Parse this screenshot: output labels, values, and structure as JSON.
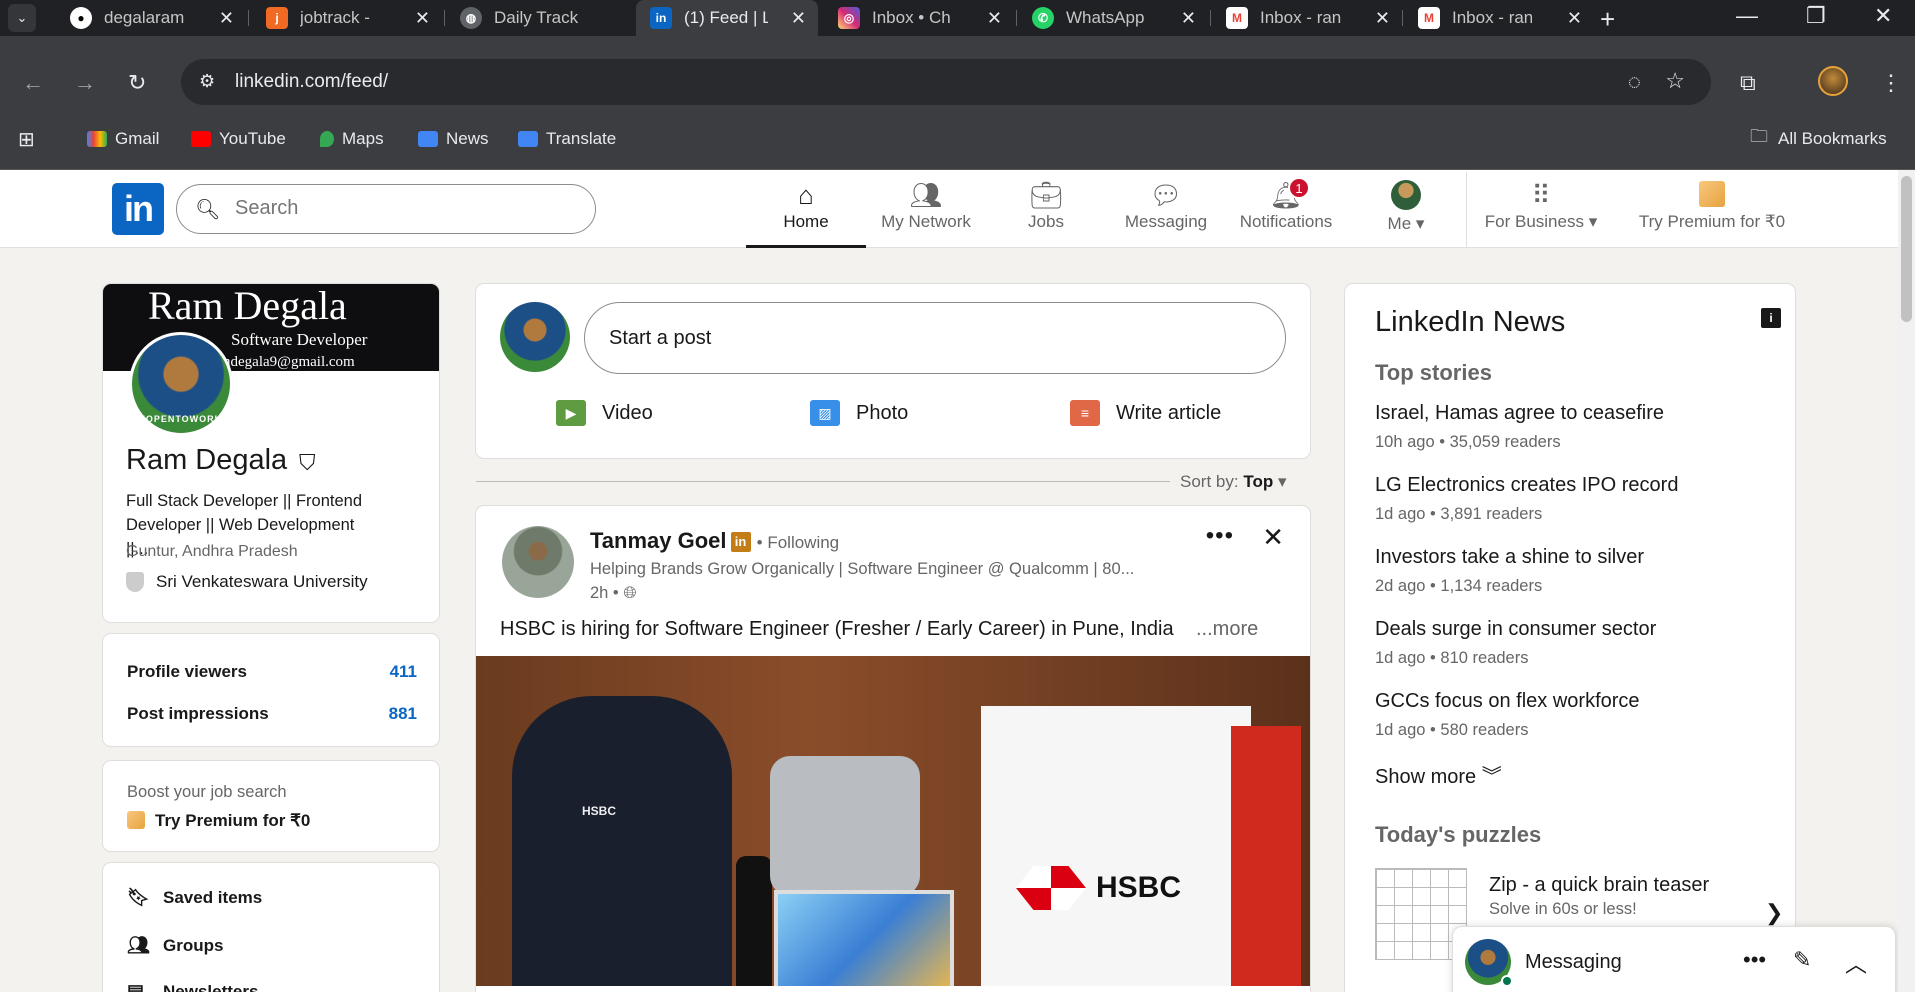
{
  "browser": {
    "tabs": [
      {
        "title": "degalaram",
        "icon": "github-icon",
        "color": "#ffffff"
      },
      {
        "title": "jobtrack -",
        "icon": "jobtrack-icon",
        "color": "#f06a23"
      },
      {
        "title": "Daily Track",
        "icon": "globe-icon",
        "color": "#9aa0a6"
      },
      {
        "title": "(1) Feed | L",
        "icon": "linkedin-icon",
        "color": "#0a66c2",
        "active": true
      },
      {
        "title": "Inbox • Ch",
        "icon": "instagram-icon",
        "color": "#e1306c"
      },
      {
        "title": "WhatsApp",
        "icon": "whatsapp-icon",
        "color": "#25d366"
      },
      {
        "title": "Inbox - ran",
        "icon": "gmail-icon",
        "color": "#ea4335"
      },
      {
        "title": "Inbox - ran",
        "icon": "gmail-icon",
        "color": "#ea4335"
      }
    ],
    "url": "linkedin.com/feed/",
    "bookmarks": [
      {
        "label": "Gmail",
        "icon": "gmail-icon"
      },
      {
        "label": "YouTube",
        "icon": "youtube-icon"
      },
      {
        "label": "Maps",
        "icon": "maps-icon"
      },
      {
        "label": "News",
        "icon": "news-icon"
      },
      {
        "label": "Translate",
        "icon": "translate-icon"
      }
    ],
    "all_bookmarks": "All Bookmarks"
  },
  "header": {
    "logo": "in",
    "search_placeholder": "Search",
    "nav": [
      {
        "label": "Home",
        "icon": "home-icon",
        "active": true
      },
      {
        "label": "My Network",
        "icon": "network-icon"
      },
      {
        "label": "Jobs",
        "icon": "briefcase-icon"
      },
      {
        "label": "Messaging",
        "icon": "chat-icon"
      },
      {
        "label": "Notifications",
        "icon": "bell-icon",
        "badge": "1"
      },
      {
        "label": "Me",
        "icon": "avatar"
      },
      {
        "label": "For Business",
        "icon": "grid-icon"
      },
      {
        "label": "Try Premium for ₹0",
        "icon": "premium-icon"
      }
    ]
  },
  "profile": {
    "cover_name": "Ram Degala",
    "cover_role": "Software Developer",
    "cover_email": "ndegala9@gmail.com",
    "badge_text": "#OPENTOWORK",
    "name": "Ram Degala",
    "headline": "Full Stack Developer || Frontend Developer || Web Development ||...",
    "location": "Guntur, Andhra Pradesh",
    "school": "Sri Venkateswara University",
    "stats": [
      {
        "label": "Profile viewers",
        "value": "411"
      },
      {
        "label": "Post impressions",
        "value": "881"
      }
    ],
    "boost_text": "Boost your job search",
    "premium_text": "Try Premium for ₹0",
    "links": [
      {
        "label": "Saved items",
        "icon": "bookmark-icon"
      },
      {
        "label": "Groups",
        "icon": "groups-icon"
      },
      {
        "label": "Newsletters",
        "icon": "newsletter-icon"
      }
    ]
  },
  "composer": {
    "placeholder": "Start a post",
    "actions": [
      {
        "label": "Video",
        "icon": "video-icon",
        "color": "#5f9b41"
      },
      {
        "label": "Photo",
        "icon": "photo-icon",
        "color": "#378fe9"
      },
      {
        "label": "Write article",
        "icon": "article-icon",
        "color": "#e06847"
      }
    ]
  },
  "sort": {
    "label": "Sort by:",
    "value": "Top"
  },
  "post": {
    "author": "Tanmay Goel",
    "following": "• Following",
    "subtitle": "Helping Brands Grow Organically | Software Engineer @ Qualcomm | 80...",
    "time": "2h •",
    "text": "HSBC is hiring for Software Engineer (Fresher / Early Career) in Pune, India",
    "more": "...more",
    "image_brand": "HSBC",
    "bag_logo": "HSBC"
  },
  "news": {
    "title": "LinkedIn News",
    "subtitle": "Top stories",
    "stories": [
      {
        "title": "Israel, Hamas agree to ceasefire",
        "meta": "10h ago • 35,059 readers"
      },
      {
        "title": "LG Electronics creates IPO record",
        "meta": "1d ago • 3,891 readers"
      },
      {
        "title": "Investors take a shine to silver",
        "meta": "2d ago • 1,134 readers"
      },
      {
        "title": "Deals surge in consumer sector",
        "meta": "1d ago • 810 readers"
      },
      {
        "title": "GCCs focus on flex workforce",
        "meta": "1d ago • 580 readers"
      }
    ],
    "show_more": "Show more ︾",
    "puzzles_title": "Today's puzzles",
    "puzzle": {
      "title": "Zip - a quick brain teaser",
      "subtitle": "Solve in 60s or less!"
    }
  },
  "messaging": {
    "label": "Messaging"
  }
}
